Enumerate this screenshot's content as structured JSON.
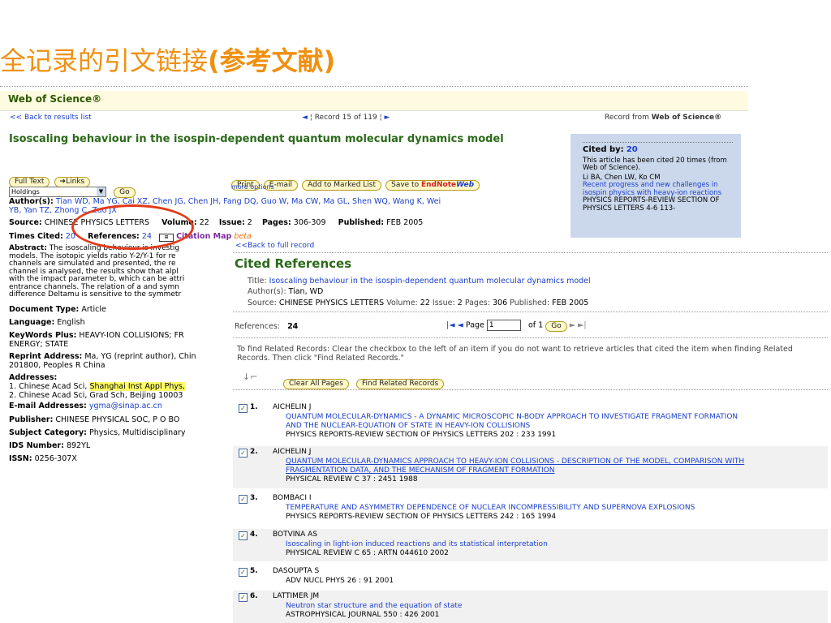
{
  "slide": {
    "title_normal": "全记录的引文链接",
    "title_bold": "(参考文献)"
  },
  "wos": {
    "brand": "Web of Science®",
    "back_results": "<< Back to results list",
    "record_label": "Record",
    "record_num": "15",
    "record_of": "of",
    "record_total": "119",
    "record_from": "Record from",
    "record_from_brand": "Web of Science®",
    "article_title": "Isoscaling behaviour in the isospin-dependent quantum molecular dynamics model",
    "buttons": {
      "full_text": "Full Text",
      "links": "Links",
      "go": "Go",
      "print": "Print",
      "email": "E-mail",
      "add_marked": "Add to Marked List",
      "save_to": "Save to",
      "endnote": "EndNote",
      "web": "Web"
    },
    "holdings": "Holdings",
    "more_options": "more options",
    "authors_label": "Author(s):",
    "authors_line1": "Tian WD, Ma YG, Cai XZ, Chen JG, Chen JH, Fang DQ, Guo W, Ma CW, Ma GL, Shen WQ, Wang K, Wei",
    "authors_line2": "YB, Yan TZ, Zhong C, Zuo JX",
    "source_label": "Source:",
    "source_value": "CHINESE PHYSICS LETTERS",
    "volume_label": "Volume:",
    "volume_value": "22",
    "issue_label": "Issue:",
    "issue_value": "2",
    "pages_label": "Pages:",
    "pages_value": "306-309",
    "published_label": "Published:",
    "published_value": "FEB 2005",
    "times_cited_label": "Times Cited:",
    "times_cited_value": "20",
    "references_label": "References:",
    "references_value": "24",
    "citation_map": "Citation Map",
    "beta": "beta",
    "abstract_label": "Abstract:",
    "abstract_lines": [
      "The isoscaling behaviour is investig",
      "models. The isotopic yields ratio Y-2/Y-1 for re",
      "channels are simulated and presented, the re",
      "channel is analysed, the results show that alpl",
      "with the impact parameter b, which can be attri",
      "entrance channels. The relation of a and symn",
      "difference Deltamu is sensitive to the symmetr"
    ],
    "doc_type_label": "Document Type:",
    "doc_type_value": "Article",
    "language_label": "Language:",
    "language_value": "English",
    "keywords_label": "KeyWords Plus:",
    "keywords_line1": "HEAVY-ION COLLISIONS; FR",
    "keywords_line2": "ENERGY; STATE",
    "reprint_label": "Reprint Address:",
    "reprint_line1": "Ma, YG (reprint author), Chin",
    "reprint_line2": "201800, Peoples R China",
    "addresses_label": "Addresses:",
    "address1_pre": "1. Chinese Acad Sci,",
    "address1_hl": "Shanghai Inst Appl Phys,",
    "address2": "2. Chinese Acad Sci, Grad Sch, Beijing 10003",
    "email_label": "E-mail Addresses:",
    "email_value": "ygma@sinap.ac.cn",
    "publisher_label": "Publisher:",
    "publisher_value": "CHINESE PHYSICAL SOC, P O BO",
    "subject_label": "Subject Category:",
    "subject_value": "Physics, Multidisciplinary",
    "ids_label": "IDS Number:",
    "ids_value": "892YL",
    "issn_label": "ISSN:",
    "issn_value": "0256-307X",
    "cited_by_label": "Cited by:",
    "cited_by_value": "20",
    "cited_note": "This article has been cited 20 times (from Web of Science).",
    "cited_item_authors": "Li BA, Chen LW, Ko CM",
    "cited_item_title": "Recent progress and new challenges in isospin physics with heavy-ion reactions",
    "cited_item_source": "PHYSICS REPORTS-REVIEW SECTION OF PHYSICS LETTERS 4-6 113-"
  },
  "refs_panel": {
    "back_full": "<<Back to full record",
    "title": "Cited References",
    "title_label": "Title:",
    "title_value": "Isoscaling behaviour in the isospin-dependent quantum molecular dynamics model",
    "authors_label": "Author(s):",
    "authors_value": "Tian, WD",
    "source_label": "Source:",
    "source_value": "CHINESE PHYSICS LETTERS",
    "volume_label": "Volume:",
    "volume_value": "22",
    "issue_label": "Issue:",
    "issue_value": "2",
    "pages_label": "Pages:",
    "pages_value": "306",
    "published_label": "Published:",
    "published_value": "FEB 2005",
    "references_label": "References:",
    "references_value": "24",
    "page_label": "Page",
    "page_value": "1",
    "of_label": "of",
    "of_value": "1",
    "go": "Go",
    "instruction_line1": "To find Related Records: Clear the checkbox to the left of an item if you do not want to retrieve articles that cited the item when finding Related",
    "instruction_line2": "Records. Then click \"Find Related Records.\"",
    "clear_all": "Clear All Pages",
    "find_related": "Find Related Records",
    "items": [
      {
        "num": "1.",
        "author": "AICHELIN J",
        "title1": "QUANTUM MOLECULAR-DYNAMICS - A DYNAMIC MICROSCOPIC N-BODY APPROACH TO INVESTIGATE FRAGMENT FORMATION",
        "title2": "AND THE NUCLEAR-EQUATION OF STATE IN HEAVY-ION COLLISIONS",
        "source": "PHYSICS REPORTS-REVIEW SECTION OF PHYSICS LETTERS 202 : 233 1991"
      },
      {
        "num": "2.",
        "author": "AICHELIN J",
        "title1": "QUANTUM MOLECULAR-DYNAMICS APPROACH TO HEAVY-ION COLLISIONS - DESCRIPTION OF THE MODEL, COMPARISON WITH",
        "title2": "FRAGMENTATION DATA, AND THE MECHANISM OF FRAGMENT FORMATION",
        "source": "PHYSICAL REVIEW C 37 : 2451 1988"
      },
      {
        "num": "3.",
        "author": "BOMBACI I",
        "title1": "TEMPERATURE AND ASYMMETRY DEPENDENCE OF NUCLEAR INCOMPRESSIBILITY AND SUPERNOVA EXPLOSIONS",
        "title2": "",
        "source": "PHYSICS REPORTS-REVIEW SECTION OF PHYSICS LETTERS 242 : 165 1994"
      },
      {
        "num": "4.",
        "author": "BOTVINA AS",
        "title1": "Isoscaling in light-ion induced reactions and its statistical interpretation",
        "title2": "",
        "source": "PHYSICAL REVIEW C 65 : ARTN 044610 2002"
      },
      {
        "num": "5.",
        "author": "DASOUPTA S",
        "title1": "",
        "title2": "",
        "source": "ADV NUCL PHYS 26 : 91 2001"
      },
      {
        "num": "6.",
        "author": "LATTIMER JM",
        "title1": "Neutron star structure and the equation of state",
        "title2": "",
        "source": "ASTROPHYSICAL JOURNAL 550 : 426 2001"
      }
    ]
  }
}
